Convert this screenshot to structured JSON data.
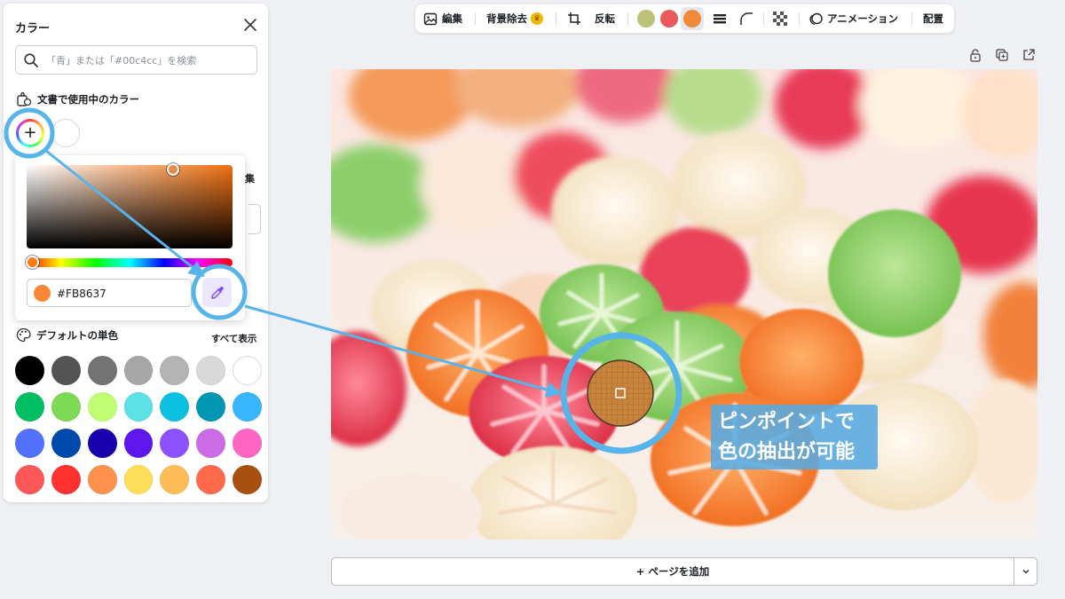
{
  "panel": {
    "title": "カラー",
    "search_placeholder": "「青」または「#00c4cc」を検索",
    "doc_colors_heading": "文書で使用中のカラー",
    "hidden_edit_label": "集",
    "default_colors_heading": "デフォルトの単色",
    "show_all_label": "すべて表示"
  },
  "picker": {
    "hex_value": "#FB8637",
    "selected_color": "#FB8637"
  },
  "default_colors": [
    [
      "#000000",
      "#545454",
      "#737373",
      "#a6a6a6",
      "#b4b4b4",
      "#d9d9d9",
      "#ffffff"
    ],
    [
      "#00bf63",
      "#7ed957",
      "#c1ff72",
      "#5ce1e6",
      "#0cc0df",
      "#0097b2",
      "#38b6ff"
    ],
    [
      "#5271ff",
      "#004aad",
      "#1800ad",
      "#5e17eb",
      "#8c52ff",
      "#cb6ce6",
      "#ff66c4"
    ],
    [
      "#ff5757",
      "#ff3131",
      "#ff914d",
      "#ffde59",
      "#ffbd59",
      "#ff6b4a",
      "#a8500f"
    ]
  ],
  "toolbar": {
    "edit_label": "編集",
    "bg_remove_label": "背景除去",
    "flip_label": "反転",
    "animation_label": "アニメーション",
    "arrange_label": "配置",
    "doc_colors": [
      "#bcc27a",
      "#ea5a5a",
      "#f08a3a"
    ]
  },
  "add_page_label": "+ ページを追加",
  "annotation": {
    "line1": "ピンポイントで",
    "line2": "色の抽出が可能",
    "accent": "#56b4ea"
  }
}
